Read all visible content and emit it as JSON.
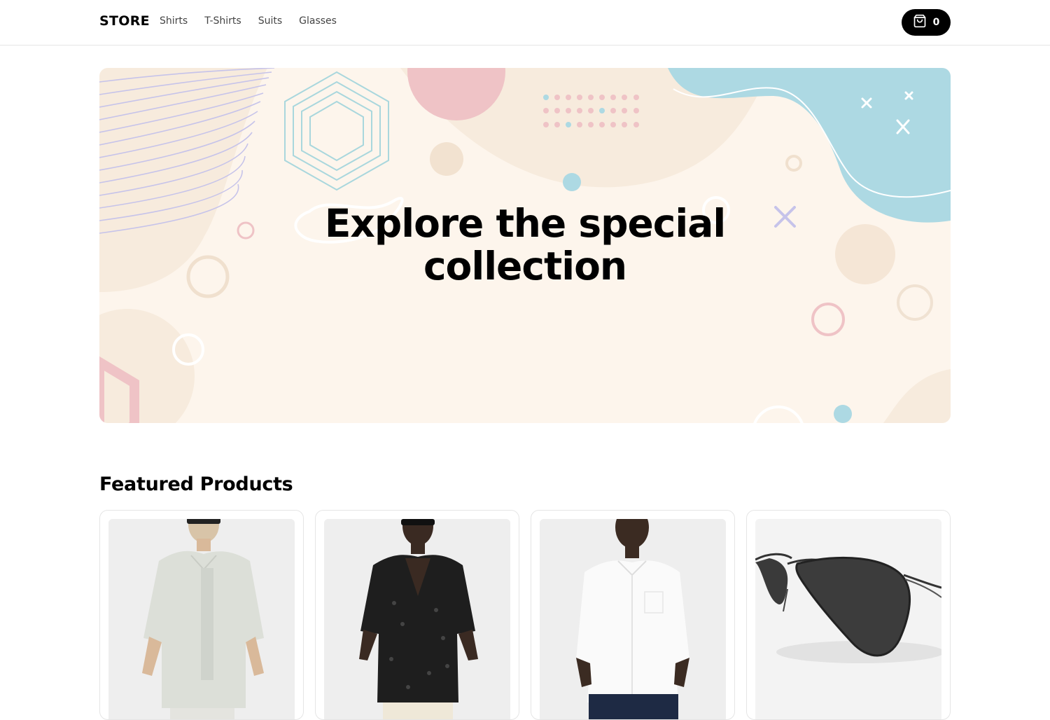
{
  "header": {
    "logo": "STORE",
    "nav": [
      "Shirts",
      "T-Shirts",
      "Suits",
      "Glasses"
    ],
    "cart": {
      "icon": "shopping-bag-icon",
      "count": "0"
    }
  },
  "hero": {
    "title_line1": "Explore the special",
    "title_line2": "collection"
  },
  "featured": {
    "title": "Featured Products",
    "products": [
      {
        "image": "man-in-light-grey-shirt"
      },
      {
        "image": "man-in-black-lace-shirt"
      },
      {
        "image": "man-in-white-shirt"
      },
      {
        "image": "aviator-sunglasses"
      }
    ]
  },
  "colors": {
    "hero_bg": "#fdf5ec",
    "accent_blue": "#add9e3",
    "accent_pink": "#efc3c6",
    "accent_lavender": "#c6c3ea",
    "button": "#000000"
  }
}
